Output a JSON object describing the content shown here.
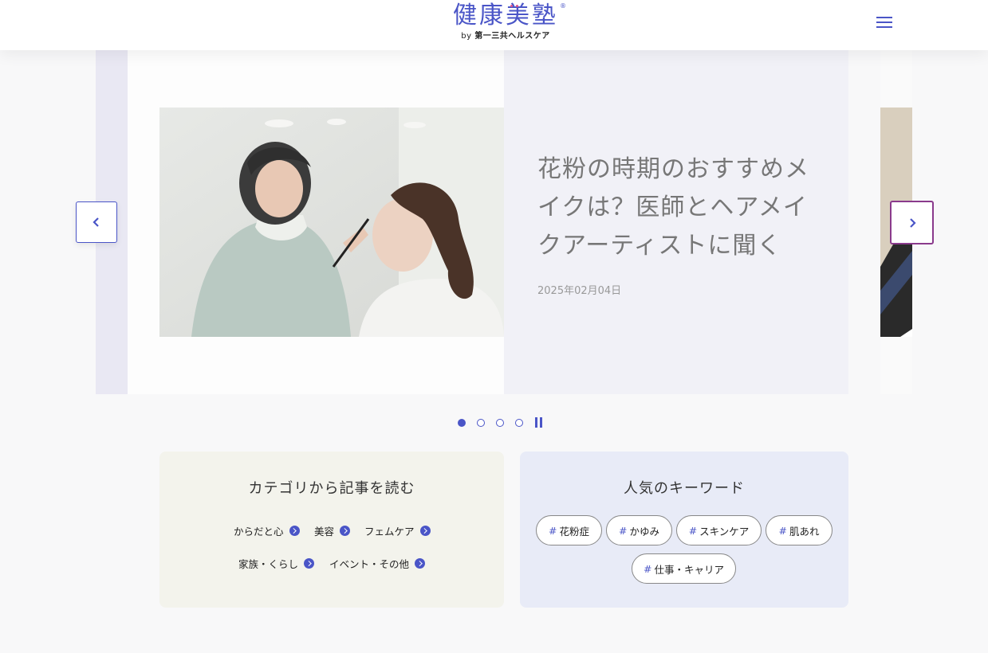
{
  "header": {
    "logo_text": "健康美塾",
    "logo_sub_prefix": "by",
    "logo_sub_brand": "第一三共ヘルスケア",
    "logo_reg": "®"
  },
  "carousel": {
    "slide": {
      "title": "花粉の時期のおすすめメイクは？医師とヘアメイクアーティストに聞く",
      "date": "2025年02月04日"
    },
    "dot_count": 4,
    "active_dot": 1
  },
  "categories": {
    "title": "カテゴリから記事を読む",
    "items": [
      "からだと心",
      "美容",
      "フェムケア",
      "家族・くらし",
      "イベント・その他"
    ]
  },
  "keywords": {
    "title": "人気のキーワード",
    "hash": "#",
    "items": [
      "花粉症",
      "かゆみ",
      "スキンケア",
      "肌あれ",
      "仕事・キャリア"
    ]
  },
  "colors": {
    "accent": "#4a55c7",
    "next_button_border": "#8a3a8c",
    "category_bg": "#f3f3ec",
    "keyword_bg": "#e8ebf7"
  }
}
